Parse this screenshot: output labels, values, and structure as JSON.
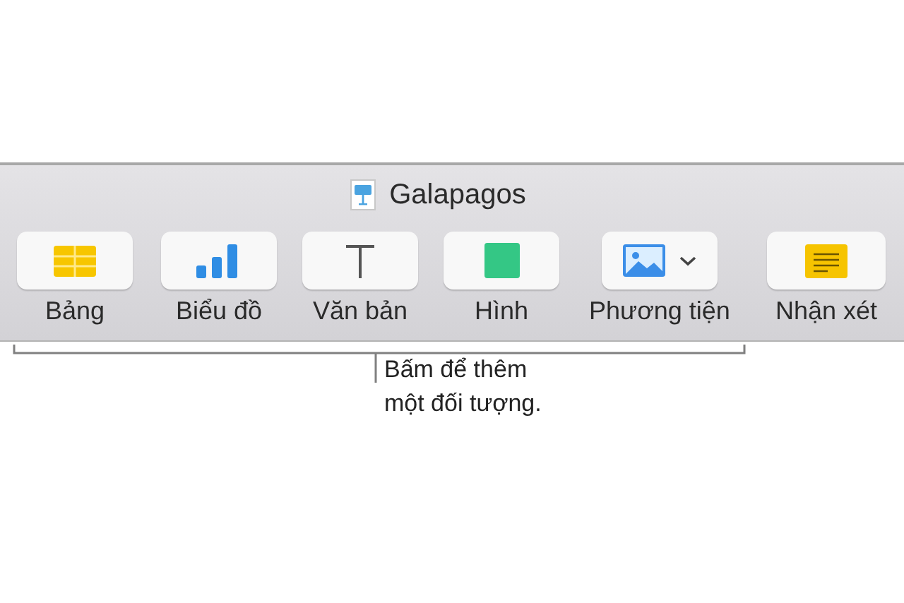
{
  "window": {
    "title": "Galapagos"
  },
  "toolbar": [
    {
      "kind": "table",
      "label": "Bảng"
    },
    {
      "kind": "chart",
      "label": "Biểu đồ"
    },
    {
      "kind": "text",
      "label": "Văn bản"
    },
    {
      "kind": "shape",
      "label": "Hình"
    },
    {
      "kind": "media",
      "label": "Phương tiện",
      "has_menu": true
    },
    {
      "kind": "comment",
      "label": "Nhận xét"
    }
  ],
  "callout": {
    "text": "Bấm để thêm một đối tượng."
  }
}
